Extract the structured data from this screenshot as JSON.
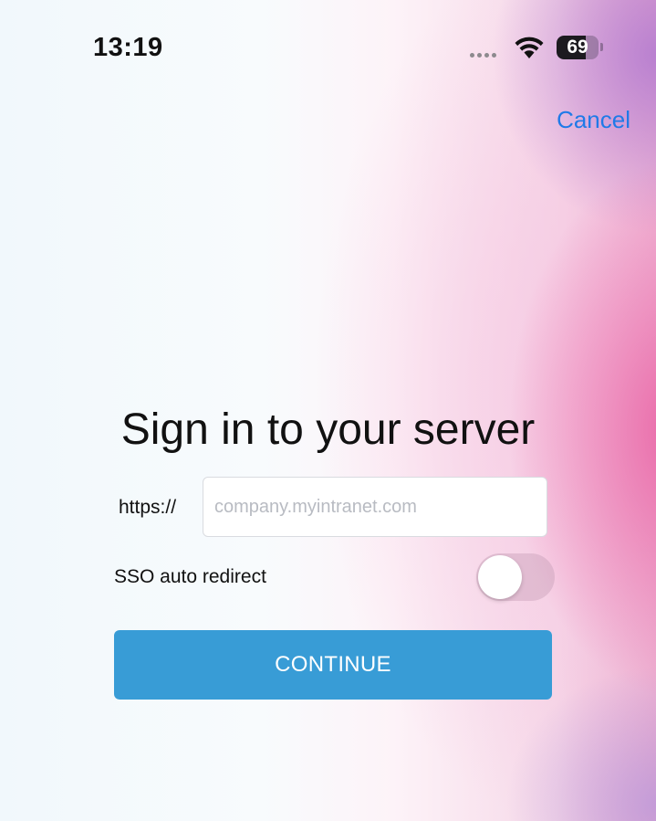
{
  "status_bar": {
    "time": "13:19",
    "battery_level": "69",
    "battery_percent": 69,
    "wifi_icon": "wifi-icon",
    "signal_icon": "cellular-signal-icon"
  },
  "header": {
    "cancel_label": "Cancel"
  },
  "main": {
    "title": "Sign in to your server",
    "scheme_label": "https://",
    "url_placeholder": "company.myintranet.com",
    "url_value": "",
    "sso_label": "SSO auto redirect",
    "sso_enabled": false,
    "continue_label": "CONTINUE"
  },
  "colors": {
    "accent": "#1f7ae8",
    "button": "#389cd6"
  }
}
